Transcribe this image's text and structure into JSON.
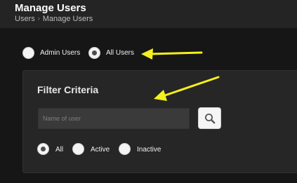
{
  "header": {
    "title": "Manage Users",
    "breadcrumb": {
      "root": "Users",
      "separator": "›",
      "current": "Manage Users"
    }
  },
  "user_type": {
    "options": [
      {
        "label": "Admin Users",
        "selected": false
      },
      {
        "label": "All Users",
        "selected": true
      }
    ]
  },
  "filter": {
    "title": "Filter Criteria",
    "search": {
      "placeholder": "Name of user",
      "value": "",
      "icon": "magnifier-icon"
    },
    "status_options": [
      {
        "label": "All",
        "selected": true
      },
      {
        "label": "Active",
        "selected": false
      },
      {
        "label": "Inactive",
        "selected": false
      }
    ]
  },
  "annotations": {
    "arrow_color": "#f5ef1e"
  },
  "colors": {
    "background": "#161616",
    "header": "#242424",
    "panel": "#262626",
    "input": "#3a3a3a"
  }
}
